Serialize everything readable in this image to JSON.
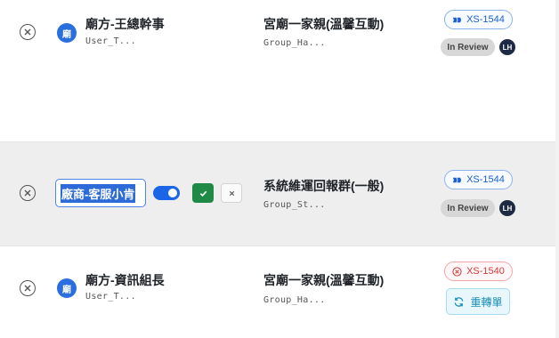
{
  "rows": [
    {
      "avatar_text": "廟",
      "name": "廟方-王總幹事",
      "user_id": "User_T...",
      "group_name": "宮廟一家親(溫馨互動)",
      "group_id": "Group_Ha...",
      "ticket": "XS-1544",
      "status": "In Review",
      "assignee": "LH"
    },
    {
      "editing_value": "廠商-客服小肯",
      "group_name": "系統維運回報群(一般)",
      "group_id": "Group_St...",
      "ticket": "XS-1544",
      "status": "In Review",
      "assignee": "LH"
    },
    {
      "avatar_text": "廟",
      "name": "廟方-資訊組長",
      "user_id": "User_T...",
      "group_name": "宮廟一家親(溫馨互動)",
      "group_id": "Group_Ha...",
      "ticket": "XS-1540",
      "action_label": "重轉單"
    }
  ],
  "colors": {
    "accent": "#1a66e6",
    "confirm": "#1e8a46",
    "error": "#d33b3b",
    "selected_row_bg": "#eeeeee"
  },
  "icons": [
    "close-circle-icon",
    "jira-icon",
    "error-circle-icon",
    "check-icon",
    "x-icon",
    "refresh-icon"
  ]
}
